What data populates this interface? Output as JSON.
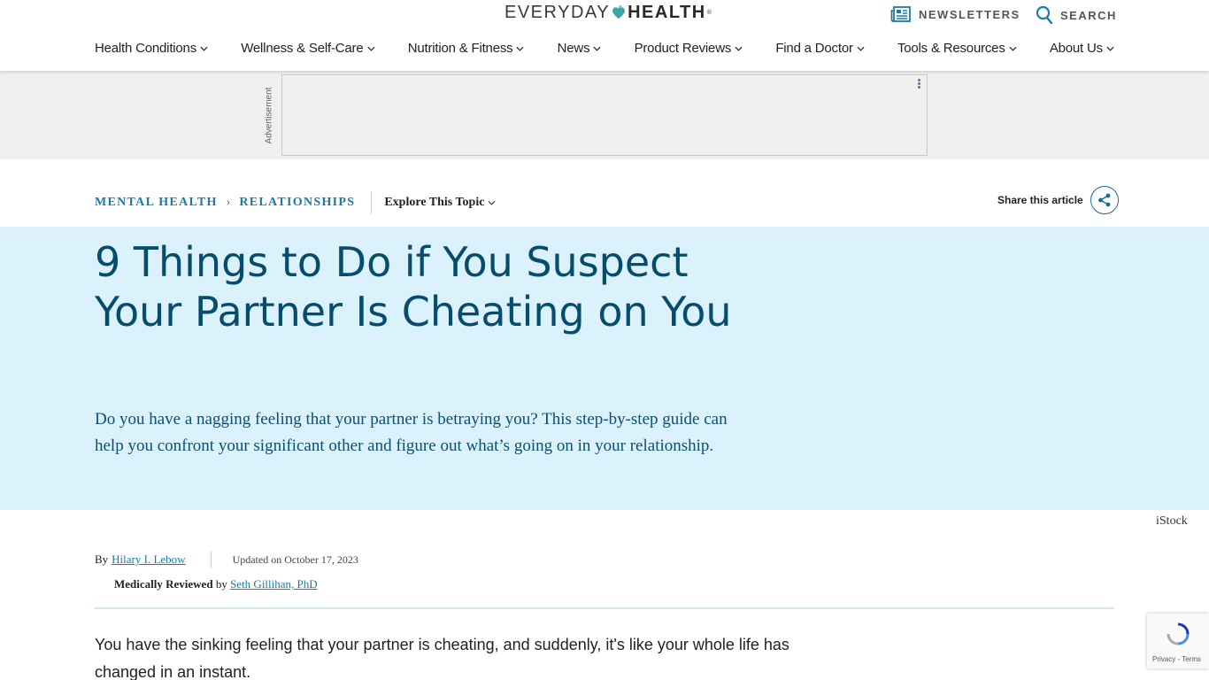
{
  "header": {
    "logo": {
      "left": "EVERYDAY",
      "right": "HEALTH",
      "tm": "®"
    },
    "newsletters_label": "NEWSLETTERS",
    "search_label": "SEARCH",
    "nav": [
      {
        "label": "Health Conditions"
      },
      {
        "label": "Wellness & Self-Care"
      },
      {
        "label": "Nutrition & Fitness"
      },
      {
        "label": "News"
      },
      {
        "label": "Product Reviews"
      },
      {
        "label": "Find a Doctor"
      },
      {
        "label": "Tools & Resources"
      },
      {
        "label": "About Us"
      }
    ]
  },
  "ad": {
    "label": "Advertisement"
  },
  "breadcrumb": {
    "items": [
      "MENTAL HEALTH",
      "RELATIONSHIPS"
    ],
    "explore_label": "Explore This Topic"
  },
  "share": {
    "label": "Share this article"
  },
  "article": {
    "title": "9 Things to Do if You Suspect Your Partner Is Cheating on You",
    "dek": "Do you have a nagging feeling that your partner is betraying you? This step-by-step guide can help you confront your significant other and figure out what’s going on in your relationship.",
    "image_credit": "iStock",
    "byline_prefix": "By",
    "author": "Hilary I. Lebow",
    "updated": "Updated on October 17, 2023",
    "reviewed_label": "Medically Reviewed",
    "reviewed_by": "by",
    "reviewer": "Seth Gillihan, PhD",
    "first_paragraph": "You have the sinking feeling that your partner is cheating, and suddenly, it's like your whole life has changed in an instant."
  },
  "recaptcha": {
    "privacy": "Privacy",
    "separator": " - ",
    "terms": "Terms"
  },
  "colors": {
    "accent": "#1b7aa5",
    "hero_bg": "#dbf1fc",
    "title": "#054d6b",
    "logo_heart": "#3aa6b0"
  }
}
